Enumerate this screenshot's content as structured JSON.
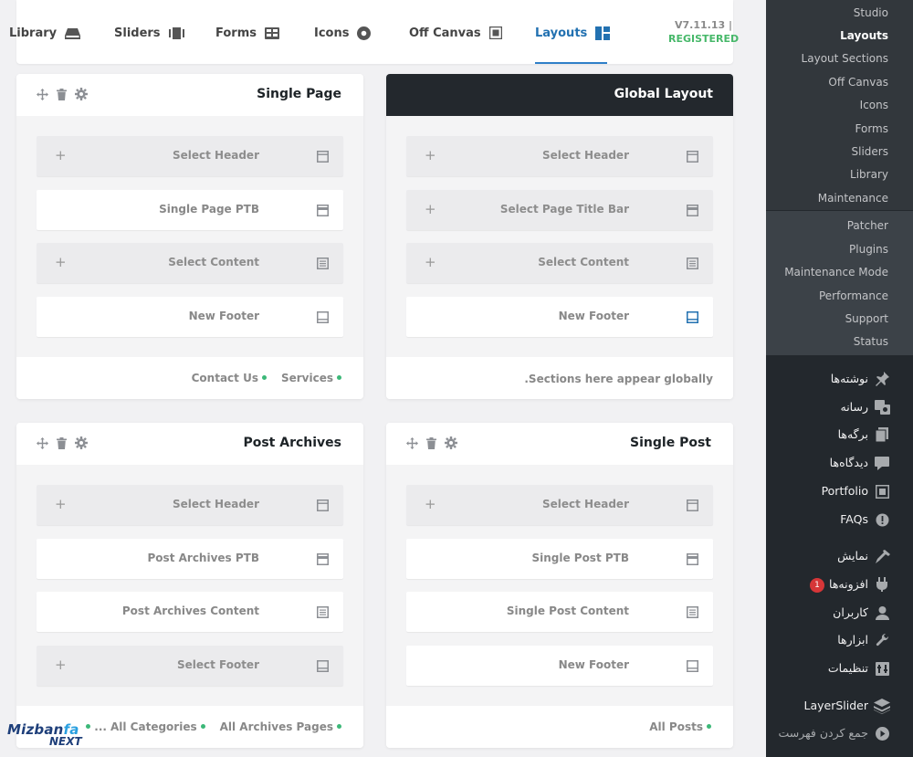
{
  "nav": {
    "items": [
      {
        "label": "Library",
        "icon": "library-icon"
      },
      {
        "label": "Sliders",
        "icon": "sliders-icon"
      },
      {
        "label": "Forms",
        "icon": "forms-icon"
      },
      {
        "label": "Icons",
        "icon": "icons-icon"
      },
      {
        "label": "Off Canvas",
        "icon": "off-canvas-icon"
      },
      {
        "label": "Layouts",
        "icon": "layouts-icon",
        "active": true
      }
    ],
    "version": "V7.11.13 |",
    "registered": "REGISTERED",
    "active_color": "#2271b1",
    "registered_color": "#47b86a"
  },
  "cards": {
    "single_page": {
      "title": "Single Page",
      "slots": [
        "Select Header",
        "Single Page PTB",
        "Select Content",
        "New Footer"
      ],
      "links": [
        "Contact Us",
        "Services"
      ]
    },
    "global_layout": {
      "title": "Global Layout",
      "slots": [
        "Select Header",
        "Select Page Title Bar",
        "Select Content",
        "New Footer"
      ],
      "footer_text": ".Sections here appear globally"
    },
    "post_archives": {
      "title": "Post Archives",
      "slots": [
        "Select Header",
        "Post Archives PTB",
        "Post Archives Content",
        "Select Footer"
      ],
      "links": [
        "...",
        "All Categories",
        "All Archives Pages"
      ]
    },
    "single_post": {
      "title": "Single Post",
      "slots": [
        "Select Header",
        "Single Post PTB",
        "Single Post Content",
        "New Footer"
      ],
      "links": [
        "All Posts"
      ]
    }
  },
  "sidebar": {
    "submenu": [
      "Studio",
      "Layouts",
      "Layout Sections",
      "Off Canvas",
      "Icons",
      "Forms",
      "Sliders",
      "Library",
      "Maintenance"
    ],
    "current": "Layouts",
    "submenu2": [
      "Patcher",
      "Plugins",
      "Maintenance Mode",
      "Performance",
      "Support",
      "Status"
    ],
    "menu": [
      {
        "label": "نوشته‌ها",
        "icon": "pin-icon"
      },
      {
        "label": "رسانه",
        "icon": "media-icon"
      },
      {
        "label": "برگه‌ها",
        "icon": "pages-icon"
      },
      {
        "label": "دیدگاه‌ها",
        "icon": "comments-icon"
      },
      {
        "label": "Portfolio",
        "icon": "portfolio-icon"
      },
      {
        "label": "FAQs",
        "icon": "faq-icon"
      },
      {
        "label": "نمایش",
        "icon": "appearance-icon"
      },
      {
        "label": "افزونه‌ها",
        "icon": "plugins-icon",
        "badge": "1"
      },
      {
        "label": "کاربران",
        "icon": "users-icon"
      },
      {
        "label": "ابزارها",
        "icon": "tools-icon"
      },
      {
        "label": "تنظیمات",
        "icon": "settings-icon"
      },
      {
        "label": "LayerSlider",
        "icon": "layers-icon"
      },
      {
        "label": "جمع کردن فهرست",
        "icon": "collapse-icon"
      }
    ]
  },
  "watermark": {
    "brand": "Mizbanfa",
    "brand_a": "Mizban",
    "brand_b": "fa",
    "sub": "NEXT"
  }
}
